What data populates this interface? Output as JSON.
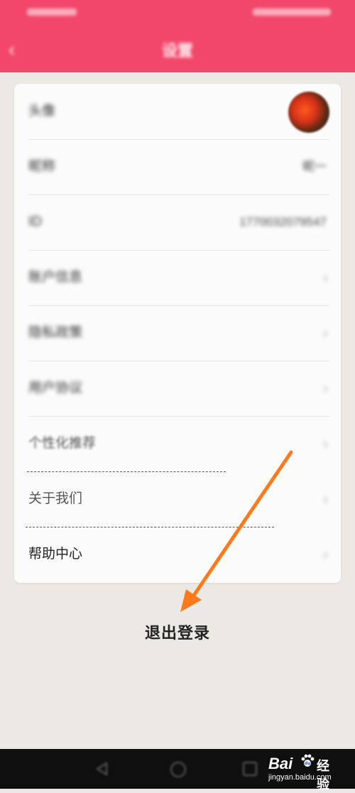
{
  "status_bar": {},
  "header": {
    "back_glyph": "‹",
    "title": "设置",
    "background_color": "#f2476a"
  },
  "settings": {
    "avatar_label": "头像",
    "nickname_label": "昵称",
    "nickname_value": "昵一",
    "id_label": "ID",
    "id_value": "1770032079547",
    "items": [
      {
        "label": "账户信息",
        "chevron": "›"
      },
      {
        "label": "隐私政策",
        "chevron": "›"
      },
      {
        "label": "用户协议",
        "chevron": "›"
      },
      {
        "label": "个性化推荐",
        "chevron": "›"
      },
      {
        "label": "关于我们",
        "chevron": "›"
      },
      {
        "label": "帮助中心",
        "chevron": "›"
      }
    ]
  },
  "logout": {
    "label": "退出登录"
  },
  "annotation": {
    "arrow_color": "#ff7a1a"
  },
  "watermark": {
    "brand_left": "Bai",
    "brand_right": "经验",
    "url": "jingyan.baidu.com"
  },
  "system_nav": {
    "icons": [
      "back-icon",
      "home-icon",
      "recent-apps-icon"
    ]
  }
}
